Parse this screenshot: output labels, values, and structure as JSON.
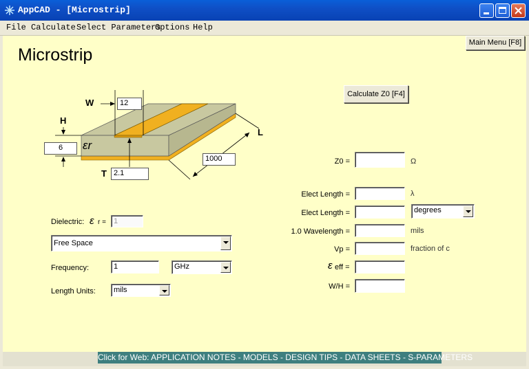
{
  "window": {
    "title": "AppCAD - [Microstrip]",
    "buttons": {
      "minimize": "minimize",
      "maximize": "maximize",
      "close": "close"
    }
  },
  "menu": [
    "File",
    "Calculate",
    "Select Parameters",
    "Options",
    "Help"
  ],
  "main_menu_button": "Main Menu [F8]",
  "page_title": "Microstrip",
  "calculate_button": "Calculate Z0  [F4]",
  "diagram": {
    "w_label": "W",
    "w_value": "12",
    "h_label": "H",
    "h_value": "6",
    "epsilon_label": "εr",
    "t_label": "T",
    "t_value": "2.1",
    "l_label": "L",
    "l_value": "1000"
  },
  "dielectric": {
    "label": "Dielectric:",
    "er_symbol": "ε",
    "er_sub": "r =",
    "er_value": "1",
    "material": "Free Space"
  },
  "frequency": {
    "label": "Frequency:",
    "value": "1",
    "unit": "GHz"
  },
  "length_units": {
    "label": "Length Units:",
    "value": "mils"
  },
  "results": {
    "z0": {
      "label": "Z0 =",
      "value": "",
      "unit": "Ω"
    },
    "elect_length_lambda": {
      "label": "Elect Length =",
      "value": "",
      "unit": "λ"
    },
    "elect_length_deg": {
      "label": "Elect Length =",
      "value": "",
      "unit": "degrees"
    },
    "wavelength": {
      "label": "1.0 Wavelength =",
      "value": "",
      "unit": "mils"
    },
    "vp": {
      "label": "Vp =",
      "value": "",
      "unit": "fraction of c"
    },
    "eeff": {
      "label_symbol": "ε",
      "label_sub": "eff =",
      "value": ""
    },
    "wh": {
      "label": "W/H =",
      "value": ""
    }
  },
  "web_links": "Click for Web: APPLICATION NOTES - MODELS - DESIGN TIPS - DATA SHEETS - S-PARAMETERS",
  "colors": {
    "client_bg": "#ffffc8",
    "strip": "#f0b020",
    "substrate": "#c8c8a0",
    "weblinks_bg": "#3e7f7f"
  }
}
